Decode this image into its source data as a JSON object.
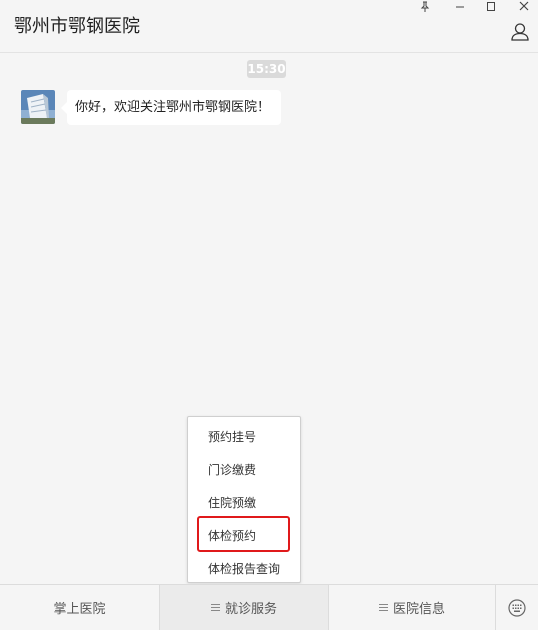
{
  "header": {
    "title": "鄂州市鄂钢医院"
  },
  "chat": {
    "time": "15:30",
    "message": "你好，欢迎关注鄂州市鄂钢医院！"
  },
  "popup": {
    "items": [
      "预约挂号",
      "门诊缴费",
      "住院预缴",
      "体检预约",
      "体检报告查询"
    ],
    "highlighted": "体检预约",
    "highlight_color": "#e0191b"
  },
  "menubar": {
    "items": [
      "掌上医院",
      "就诊服务",
      "医院信息"
    ],
    "active": "就诊服务"
  },
  "icons": {
    "window": [
      "pin-icon",
      "minimize-icon",
      "maximize-icon",
      "close-icon"
    ],
    "profile": "user-icon",
    "keyboard": "keyboard-toggle-icon"
  }
}
